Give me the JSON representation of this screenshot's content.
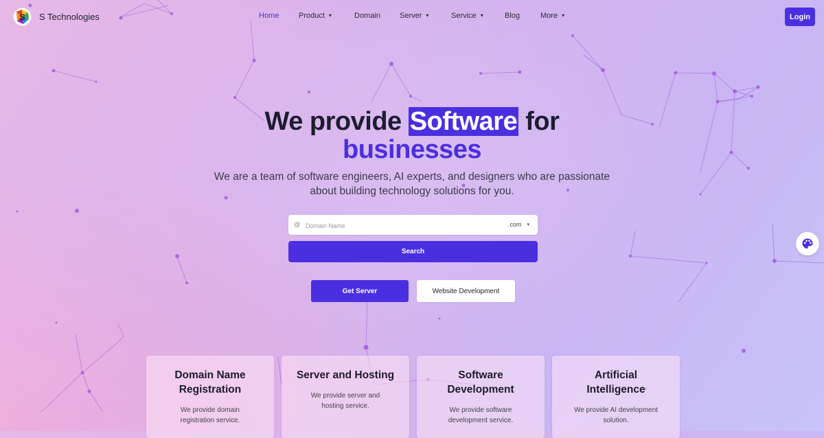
{
  "brand": {
    "name": "S Technologies",
    "logo_letter": "S"
  },
  "nav": {
    "items": [
      {
        "label": "Home",
        "active": true,
        "dropdown": false
      },
      {
        "label": "Product",
        "active": false,
        "dropdown": true
      },
      {
        "label": "Domain",
        "active": false,
        "dropdown": false
      },
      {
        "label": "Server",
        "active": false,
        "dropdown": true
      },
      {
        "label": "Service",
        "active": false,
        "dropdown": true
      },
      {
        "label": "Blog",
        "active": false,
        "dropdown": false
      },
      {
        "label": "More",
        "active": false,
        "dropdown": true
      }
    ],
    "login_label": "Login",
    "chevron": "▾"
  },
  "hero": {
    "title_before": "We provide ",
    "title_highlight": "Software",
    "title_after": " for",
    "title_line2": "businesses",
    "description": "We are a team of software engineers, AI experts, and designers who are passionate about building technology solutions for you."
  },
  "search": {
    "placeholder": "Domain Name",
    "tld_selected": ".com",
    "button_label": "Search",
    "globe_icon": "@"
  },
  "actions": {
    "primary_label": "Get Server",
    "secondary_label": "Website Development"
  },
  "cards": [
    {
      "title": "Domain Name Registration",
      "description": "We provide domain registration service."
    },
    {
      "title": "Server and Hosting",
      "description": "We provide server and hosting service."
    },
    {
      "title": "Software Development",
      "description": "We provide software development service."
    },
    {
      "title": "Artificial Intelligence",
      "description": "We provide AI development solution."
    }
  ],
  "colors": {
    "accent": "#4a2fe0",
    "text_dark": "#1d1d30",
    "network": "#9b4fd8"
  },
  "icons": {
    "palette": "palette-icon",
    "globe": "globe-icon",
    "chevron": "chevron-down-icon"
  }
}
